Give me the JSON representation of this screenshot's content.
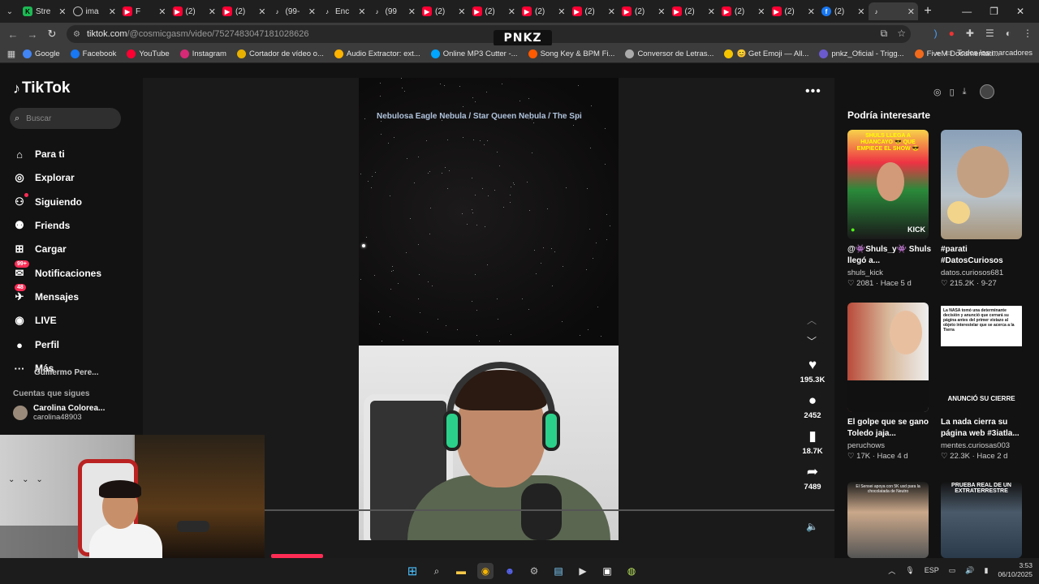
{
  "browser": {
    "tabs": [
      {
        "title": "Stre",
        "icon": "green-k-icon",
        "cls": "gr",
        "glyph": "K"
      },
      {
        "title": "ima",
        "icon": "globe-icon",
        "cls": "gl",
        "glyph": ""
      },
      {
        "title": "F",
        "icon": "youtube-icon",
        "cls": "yt",
        "glyph": "▶"
      },
      {
        "title": "(2)",
        "icon": "youtube-icon",
        "cls": "yt",
        "glyph": "▶"
      },
      {
        "title": "(2)",
        "icon": "youtube-icon",
        "cls": "yt",
        "glyph": "▶"
      },
      {
        "title": "(99-",
        "icon": "tiktok-icon",
        "cls": "tt",
        "glyph": "♪"
      },
      {
        "title": "Enc",
        "icon": "tiktok-icon",
        "cls": "tt",
        "glyph": "♪"
      },
      {
        "title": "(99",
        "icon": "tiktok-icon",
        "cls": "tt",
        "glyph": "♪"
      },
      {
        "title": "(2)",
        "icon": "youtube-icon",
        "cls": "yt",
        "glyph": "▶"
      },
      {
        "title": "(2)",
        "icon": "youtube-icon",
        "cls": "yt",
        "glyph": "▶"
      },
      {
        "title": "(2)",
        "icon": "youtube-icon",
        "cls": "yt",
        "glyph": "▶"
      },
      {
        "title": "(2)",
        "icon": "youtube-icon",
        "cls": "yt",
        "glyph": "▶"
      },
      {
        "title": "(2)",
        "icon": "youtube-icon",
        "cls": "yt",
        "glyph": "▶"
      },
      {
        "title": "(2)",
        "icon": "youtube-icon",
        "cls": "yt",
        "glyph": "▶"
      },
      {
        "title": "(2)",
        "icon": "youtube-icon",
        "cls": "yt",
        "glyph": "▶"
      },
      {
        "title": "(2)",
        "icon": "youtube-icon",
        "cls": "yt",
        "glyph": "▶"
      },
      {
        "title": "(2)",
        "icon": "facebook-icon",
        "cls": "fb",
        "glyph": "f"
      },
      {
        "title": "",
        "icon": "tiktok-icon",
        "cls": "tt",
        "glyph": "♪",
        "active": true
      }
    ],
    "url_host": "tiktok.com",
    "url_path": "/@cosmicgasm/video/7527483047181028626",
    "center_logo": "PNKZ",
    "bookmarks": [
      {
        "label": "Google",
        "icon": "google-icon",
        "color": "#4285f4"
      },
      {
        "label": "Facebook",
        "icon": "facebook-icon",
        "color": "#1877f2"
      },
      {
        "label": "YouTube",
        "icon": "youtube-icon",
        "color": "#ff0033"
      },
      {
        "label": "Instagram",
        "icon": "instagram-icon",
        "color": "#d62976"
      },
      {
        "label": "Cortador de vídeo o...",
        "icon": "scissors-icon",
        "color": "#e8b100"
      },
      {
        "label": "Audio Extractor: ext...",
        "icon": "audio-icon",
        "color": "#ffb400"
      },
      {
        "label": "Online MP3 Cutter -...",
        "icon": "mp3-icon",
        "color": "#00a6ff"
      },
      {
        "label": "Song Key & BPM Fi...",
        "icon": "music-icon",
        "color": "#ff5a00"
      },
      {
        "label": "Conversor de Letras...",
        "icon": "letters-icon",
        "color": "#aaaaaa"
      },
      {
        "label": "😊 Get Emoji — All...",
        "icon": "emoji-icon",
        "color": "#f5c400"
      },
      {
        "label": "pnkz_Oficial - Trigg...",
        "icon": "trigger-icon",
        "color": "#6a5acd"
      },
      {
        "label": "FiveM Documentati...",
        "icon": "fivem-icon",
        "color": "#f26a1b"
      }
    ],
    "all_bookmarks": "Todos los marcadores"
  },
  "tiktok": {
    "logo": "TikTok",
    "search_placeholder": "Buscar",
    "nav": [
      {
        "label": "Para ti",
        "icon": "home-icon"
      },
      {
        "label": "Explorar",
        "icon": "compass-icon"
      },
      {
        "label": "Siguiendo",
        "icon": "following-icon"
      },
      {
        "label": "Friends",
        "icon": "friends-icon"
      },
      {
        "label": "Cargar",
        "icon": "upload-icon"
      },
      {
        "label": "Notificaciones",
        "icon": "bell-icon",
        "badge": "99+"
      },
      {
        "label": "Mensajes",
        "icon": "message-icon",
        "badge": "48"
      },
      {
        "label": "LIVE",
        "icon": "live-icon"
      },
      {
        "label": "Perfil",
        "icon": "profile-icon"
      },
      {
        "label": "Más",
        "icon": "more-icon"
      }
    ],
    "following_header": "Cuentas que sigues",
    "following": [
      {
        "name": "Carolina Colorea...",
        "handle": "carolina48903"
      },
      {
        "name": "Guillermo Pere..."
      }
    ],
    "video": {
      "caption": "Nebulosa  Eagle Nebula / Star Queen Nebula / The Spi",
      "likes": "195.3K",
      "comments": "2452",
      "saves": "18.7K",
      "shares": "7489"
    },
    "recommend_title": "Podría interesarte",
    "cards": [
      {
        "title": "@👾Shuls_y👾 Shuls llegó a...",
        "author": "shuls_kick",
        "meta": "2081 · Hace 5 d",
        "thumb_text": "SHULS LLEGA A HUANCAYO 😎 QUE EMPIECE EL SHOW 😎"
      },
      {
        "title": "#parati #DatosCuriosos",
        "author": "datos.curiosos681",
        "meta": "215.2K · 9-27",
        "thumb_text": ""
      },
      {
        "title": "El golpe que se gano Toledo jaja...",
        "author": "peruchows",
        "meta": "17K · Hace 4 d",
        "thumb_text": ""
      },
      {
        "title": "La nada cierra su página web #3iatla...",
        "author": "mentes.curiosas003",
        "meta": "22.3K · Hace 2 d",
        "thumb_text": "La NASA tomó una determinante decisión y anunció que cerrará su página antes del primer vistazo al objeto interestelar que se acerca a la Tierra"
      },
      {
        "title": "",
        "author": "",
        "meta": "",
        "thumb_text": "El Sensei apoya con 5K usd para la chocolatada de Neutro"
      },
      {
        "title": "",
        "author": "",
        "meta": "",
        "thumb_text": "PRUEBA REAL DE UN EXTRATERRESTRE"
      }
    ],
    "card_overlay": "ANUNCIÓ SU CIERRE",
    "kick_label": "KICK"
  },
  "taskbar": {
    "lang": "ESP",
    "time": "3:53",
    "date": "06/10/2025"
  }
}
